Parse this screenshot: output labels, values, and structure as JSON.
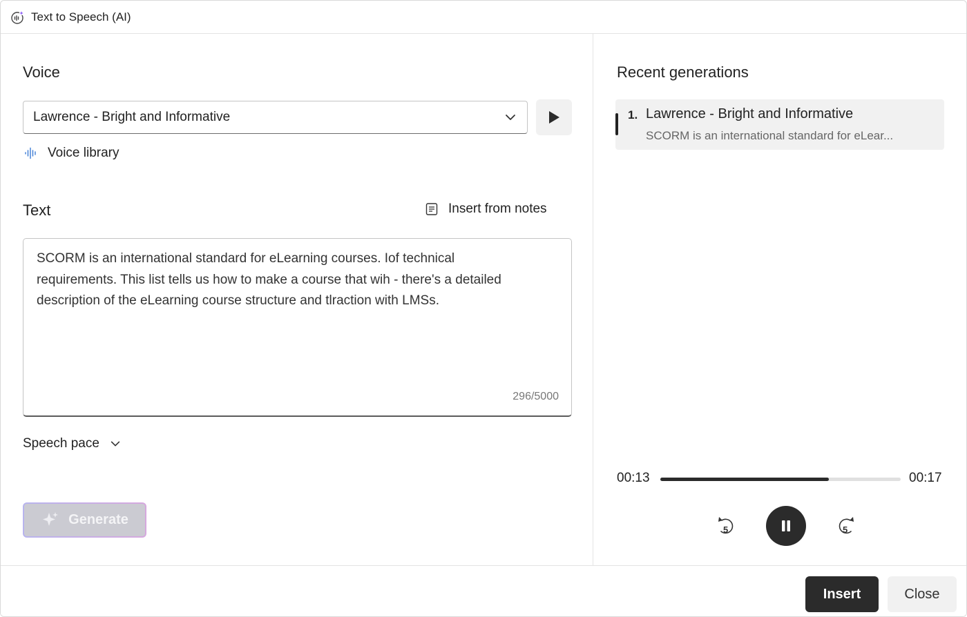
{
  "window": {
    "title": "Text to Speech (AI)"
  },
  "voice": {
    "label": "Voice",
    "selected": "Lawrence - Bright and Informative",
    "library_label": "Voice library"
  },
  "text": {
    "label": "Text",
    "insert_from_notes_label": "Insert from notes",
    "content": "SCORM is an international standard for eLearning courses. Iof technical requirements. This list tells us how to make a course that wih - there's a detailed description of the eLearning course structure and tlraction with LMSs.",
    "char_count": "296/5000"
  },
  "speech_pace": {
    "label": "Speech pace"
  },
  "generate": {
    "label": "Generate"
  },
  "recent": {
    "label": "Recent generations",
    "items": [
      {
        "index": "1.",
        "name": "Lawrence - Bright and Informative",
        "snippet": "SCORM is an international standard for eLear..."
      }
    ]
  },
  "player": {
    "current_time": "00:13",
    "total_time": "00:17",
    "progress": 0.7,
    "skip_seconds": "5"
  },
  "footer": {
    "insert_label": "Insert",
    "close_label": "Close"
  }
}
